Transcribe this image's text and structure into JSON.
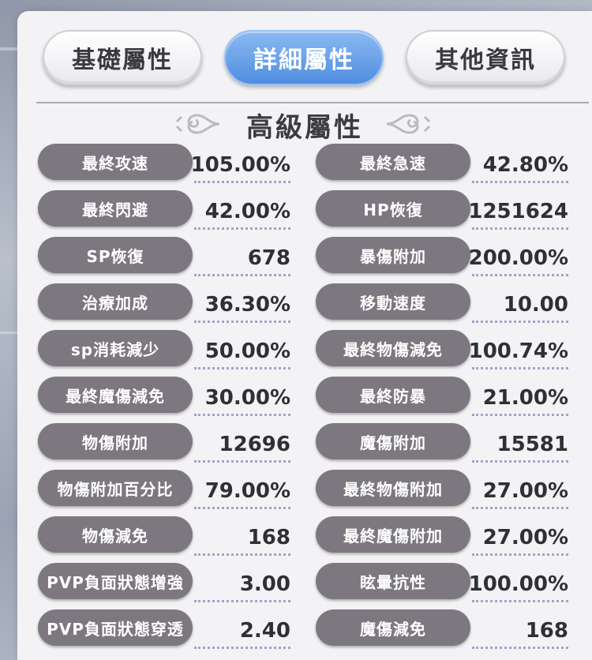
{
  "tabs": [
    {
      "label": "基礎屬性",
      "active": false
    },
    {
      "label": "詳細屬性",
      "active": true
    },
    {
      "label": "其他資訊",
      "active": false
    }
  ],
  "section_title": "高級屬性",
  "colors": {
    "active_tab": "#5a97e4",
    "label_pill": "#7d7880",
    "value_text": "#2f3034",
    "panel_bg": "#f3f3f5"
  },
  "stats": [
    {
      "left": {
        "label": "最終攻速",
        "value": "105.00%"
      },
      "right": {
        "label": "最終急速",
        "value": "42.80%"
      }
    },
    {
      "left": {
        "label": "最終閃避",
        "value": "42.00%"
      },
      "right": {
        "label": "HP恢復",
        "value": "1251624"
      }
    },
    {
      "left": {
        "label": "SP恢復",
        "value": "678"
      },
      "right": {
        "label": "暴傷附加",
        "value": "200.00%"
      }
    },
    {
      "left": {
        "label": "治療加成",
        "value": "36.30%"
      },
      "right": {
        "label": "移動速度",
        "value": "10.00"
      }
    },
    {
      "left": {
        "label": "sp消耗減少",
        "value": "50.00%"
      },
      "right": {
        "label": "最終物傷減免",
        "value": "100.74%"
      }
    },
    {
      "left": {
        "label": "最終魔傷減免",
        "value": "30.00%"
      },
      "right": {
        "label": "最終防暴",
        "value": "21.00%"
      }
    },
    {
      "left": {
        "label": "物傷附加",
        "value": "12696"
      },
      "right": {
        "label": "魔傷附加",
        "value": "15581"
      }
    },
    {
      "left": {
        "label": "物傷附加百分比",
        "value": "79.00%"
      },
      "right": {
        "label": "最終物傷附加",
        "value": "27.00%"
      }
    },
    {
      "left": {
        "label": "物傷減免",
        "value": "168"
      },
      "right": {
        "label": "最終魔傷附加",
        "value": "27.00%"
      }
    },
    {
      "left": {
        "label": "PVP負面狀態增強",
        "value": "3.00"
      },
      "right": {
        "label": "眩暈抗性",
        "value": "100.00%"
      }
    },
    {
      "left": {
        "label": "PVP負面狀態穿透",
        "value": "2.40"
      },
      "right": {
        "label": "魔傷減免",
        "value": "168"
      }
    }
  ]
}
